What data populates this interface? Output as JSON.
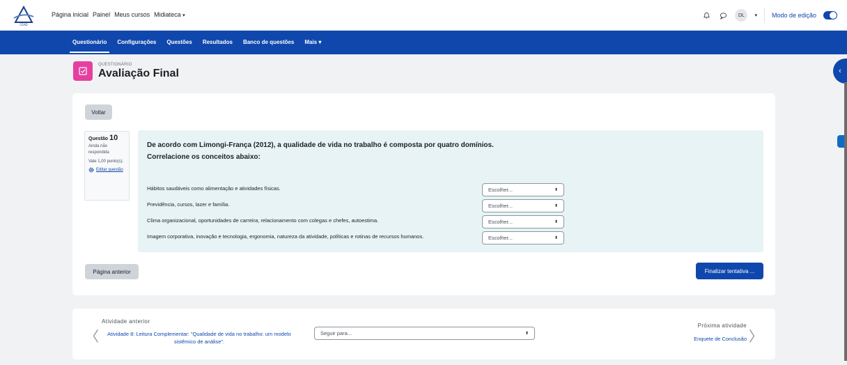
{
  "nav": {
    "logo_text": "CEAD",
    "items": [
      {
        "label": "Página inicial"
      },
      {
        "label": "Painel"
      },
      {
        "label": "Meus cursos"
      },
      {
        "label": "Midiateca"
      }
    ],
    "user_initials": "DL",
    "edit_mode_label": "Modo de edição",
    "edit_mode_on": true
  },
  "secondary_nav": {
    "tabs": [
      {
        "label": "Questionário",
        "active": true
      },
      {
        "label": "Configurações"
      },
      {
        "label": "Questões"
      },
      {
        "label": "Resultados"
      },
      {
        "label": "Banco de questões"
      },
      {
        "label": "Mais"
      }
    ]
  },
  "header": {
    "module_type": "QUESTIONÁRIO",
    "title": "Avaliação Final"
  },
  "quiz": {
    "back_label": "Voltar",
    "question_label": "Questão",
    "question_number": "10",
    "status": "Ainda não respondida",
    "points": "Vale 1,00 ponto(s).",
    "edit_label": "Editar questão",
    "question_text_line1": "De acordo com Limongi-França (2012), a qualidade de vida no trabalho é composta por quatro domínios.",
    "question_text_line2": "Correlacione os conceitos abaixo:",
    "rows": [
      {
        "text": "Hábitos saudáveis como alimentação e atividades físicas.",
        "select": "Escolher..."
      },
      {
        "text": "Previdência, cursos, lazer e família.",
        "select": "Escolher..."
      },
      {
        "text": "Clima organizacional, oportunidades de carreira, relacionamento com colegas e chefes, autoestima.",
        "select": "Escolher..."
      },
      {
        "text": "Imagem corporativa, inovação e tecnologia, ergonomia, natureza da atividade, políticas e rotinas de recursos humanos.",
        "select": "Escolher..."
      }
    ],
    "prev_page_label": "Página anterior",
    "finish_label": "Finalizar tentativa ..."
  },
  "activity_nav": {
    "prev_heading": "Atividade anterior",
    "prev_link": "Atividade 8: Leitura Complementar: \"Qualidade de vida no trabalho: um modelo sistêmico de análise\".",
    "jump_placeholder": "Seguir para...",
    "next_heading": "Próxima atividade",
    "next_link": "Enquete de Conclusão"
  },
  "colors": {
    "brand": "#0f47ad",
    "module_icon": "#e5409f",
    "question_bg": "#e7f3f5"
  }
}
